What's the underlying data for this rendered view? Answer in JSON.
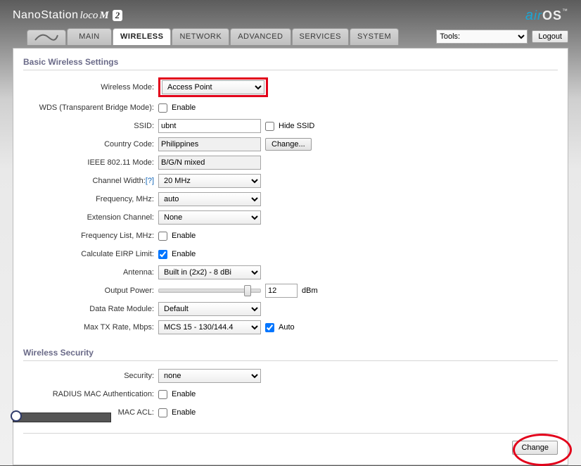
{
  "brand": {
    "p1": "NanoStation",
    "p2": "loco",
    "p3": "M",
    "p4": "2"
  },
  "oslogo": {
    "a": "a",
    "ir": "ir",
    "os": "OS",
    "tm": "™"
  },
  "tabs": {
    "main": "MAIN",
    "wireless": "WIRELESS",
    "network": "NETWORK",
    "advanced": "ADVANCED",
    "services": "SERVICES",
    "system": "SYSTEM"
  },
  "tools": {
    "label": "Tools:"
  },
  "logout": "Logout",
  "section_basic": "Basic Wireless Settings",
  "section_security": "Wireless Security",
  "labels": {
    "wireless_mode": "Wireless Mode:",
    "wds": "WDS (Transparent Bridge Mode):",
    "ssid": "SSID:",
    "hide_ssid": "Hide SSID",
    "country": "Country Code:",
    "ieee": "IEEE 802.11 Mode:",
    "ch_width": "Channel Width:",
    "help": "[?]",
    "freq": "Frequency, MHz:",
    "ext_ch": "Extension Channel:",
    "freq_list": "Frequency List, MHz:",
    "eirp": "Calculate EIRP Limit:",
    "antenna": "Antenna:",
    "out_power": "Output Power:",
    "dbm": "dBm",
    "data_rate": "Data Rate Module:",
    "max_tx": "Max TX Rate, Mbps:",
    "auto": "Auto",
    "enable": "Enable",
    "security": "Security:",
    "radius": "RADIUS MAC Authentication:",
    "mac_acl": "MAC ACL:"
  },
  "values": {
    "wireless_mode": "Access Point",
    "ssid": "ubnt",
    "country": "Philippines",
    "ieee": "B/G/N mixed",
    "ch_width": "20 MHz",
    "freq": "auto",
    "ext_ch": "None",
    "antenna": "Built in (2x2) - 8 dBi",
    "out_power": "12",
    "data_rate": "Default",
    "max_tx": "MCS 15 - 130/144.4",
    "security": "none"
  },
  "buttons": {
    "change_small": "Change...",
    "change": "Change"
  },
  "checked": {
    "wds": false,
    "hide_ssid": false,
    "freq_list": false,
    "eirp": true,
    "auto_tx": true,
    "radius": false,
    "mac_acl": false
  }
}
